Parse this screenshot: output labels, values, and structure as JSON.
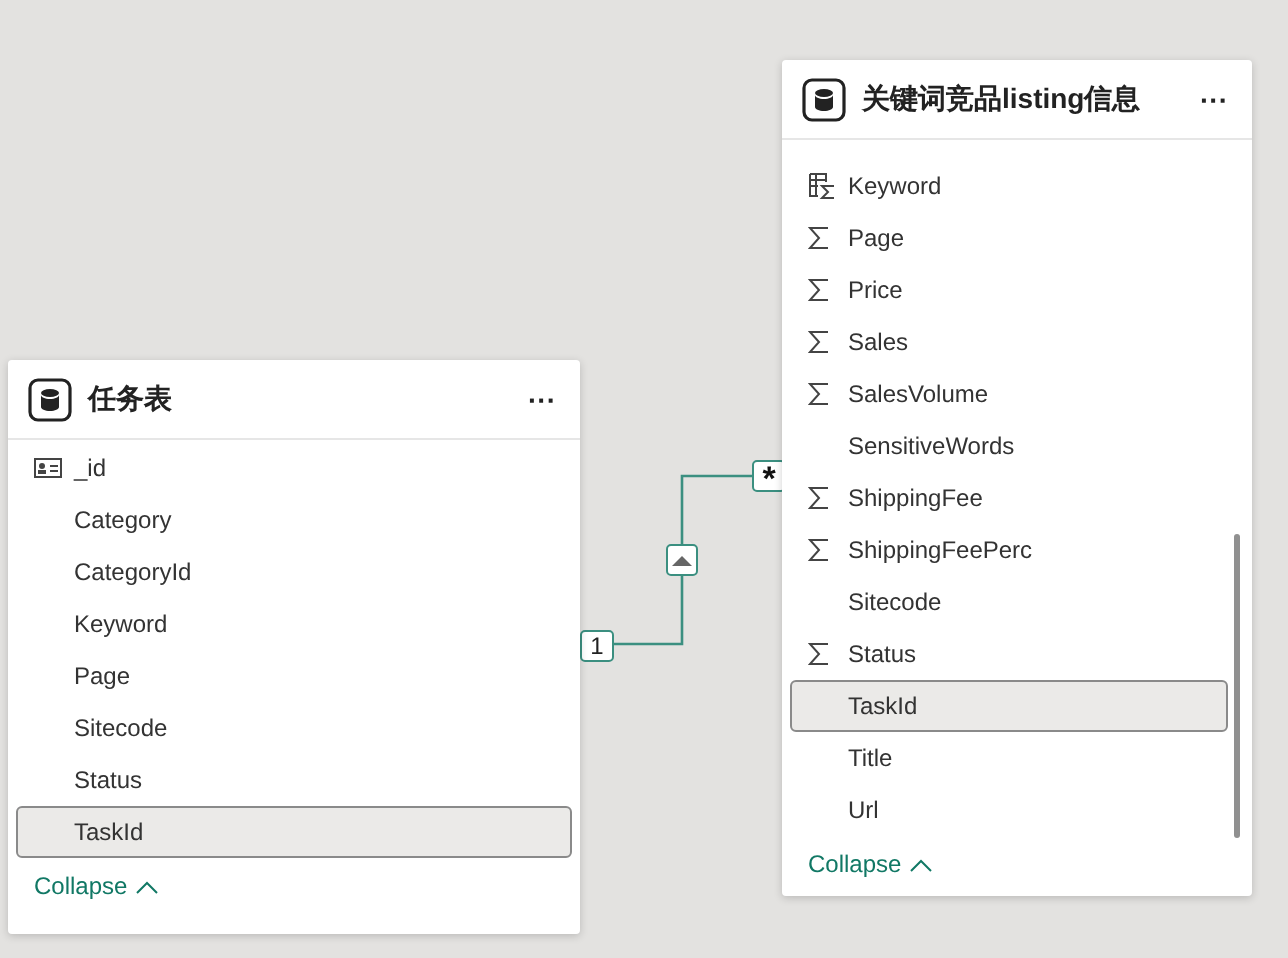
{
  "tables": [
    {
      "title": "任务表",
      "more": "···",
      "fields": [
        {
          "name": "_id",
          "kind": "id",
          "selected": false
        },
        {
          "name": "Category",
          "kind": "plain",
          "selected": false
        },
        {
          "name": "CategoryId",
          "kind": "plain",
          "selected": false
        },
        {
          "name": "Keyword",
          "kind": "plain",
          "selected": false
        },
        {
          "name": "Page",
          "kind": "plain",
          "selected": false
        },
        {
          "name": "Sitecode",
          "kind": "plain",
          "selected": false
        },
        {
          "name": "Status",
          "kind": "plain",
          "selected": false
        },
        {
          "name": "TaskId",
          "kind": "plain",
          "selected": true
        }
      ],
      "collapse": "Collapse"
    },
    {
      "title": "关键词竞品listing信息",
      "more": "···",
      "fields": [
        {
          "name": "Keyword",
          "kind": "calc",
          "selected": false
        },
        {
          "name": "Page",
          "kind": "sum",
          "selected": false
        },
        {
          "name": "Price",
          "kind": "sum",
          "selected": false
        },
        {
          "name": "Sales",
          "kind": "sum",
          "selected": false
        },
        {
          "name": "SalesVolume",
          "kind": "sum",
          "selected": false
        },
        {
          "name": "SensitiveWords",
          "kind": "plain",
          "selected": false
        },
        {
          "name": "ShippingFee",
          "kind": "sum",
          "selected": false
        },
        {
          "name": "ShippingFeePerc",
          "kind": "sum",
          "selected": false
        },
        {
          "name": "Sitecode",
          "kind": "plain",
          "selected": false
        },
        {
          "name": "Status",
          "kind": "sum",
          "selected": false
        },
        {
          "name": "TaskId",
          "kind": "plain",
          "selected": true
        },
        {
          "name": "Title",
          "kind": "plain",
          "selected": false
        },
        {
          "name": "Url",
          "kind": "plain",
          "selected": false
        }
      ],
      "collapse": "Collapse"
    }
  ],
  "relationship": {
    "from_cardinality": "1",
    "to_cardinality": "*",
    "single_direction": true
  }
}
